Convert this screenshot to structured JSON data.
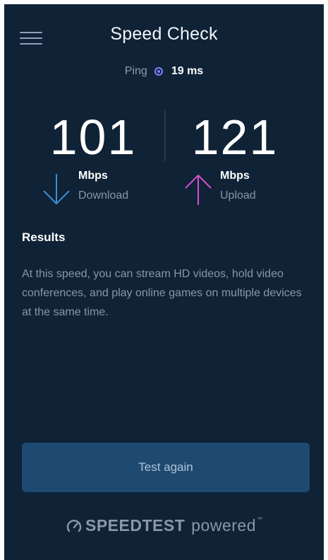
{
  "header": {
    "title": "Speed Check",
    "menu_icon": "hamburger-menu-icon"
  },
  "ping": {
    "label": "Ping",
    "value": "19 ms",
    "icon": "radio-dot-icon"
  },
  "download": {
    "value": "101",
    "unit": "Mbps",
    "label": "Download",
    "icon": "arrow-down-icon",
    "color": "#3a8fd6"
  },
  "upload": {
    "value": "121",
    "unit": "Mbps",
    "label": "Upload",
    "icon": "arrow-up-icon",
    "color": "#d94fd0"
  },
  "results": {
    "heading": "Results",
    "text": "At this speed, you can stream HD videos, hold video conferences, and play online games on multiple devices at the same time."
  },
  "actions": {
    "test_again_label": "Test again"
  },
  "footer": {
    "brand_name": "SPEEDTEST",
    "brand_suffix": "powered",
    "trademark": "™",
    "icon": "speedometer-icon"
  },
  "colors": {
    "background": "#0f2236",
    "accent": "#7b83ff",
    "button": "#1e4a72"
  }
}
